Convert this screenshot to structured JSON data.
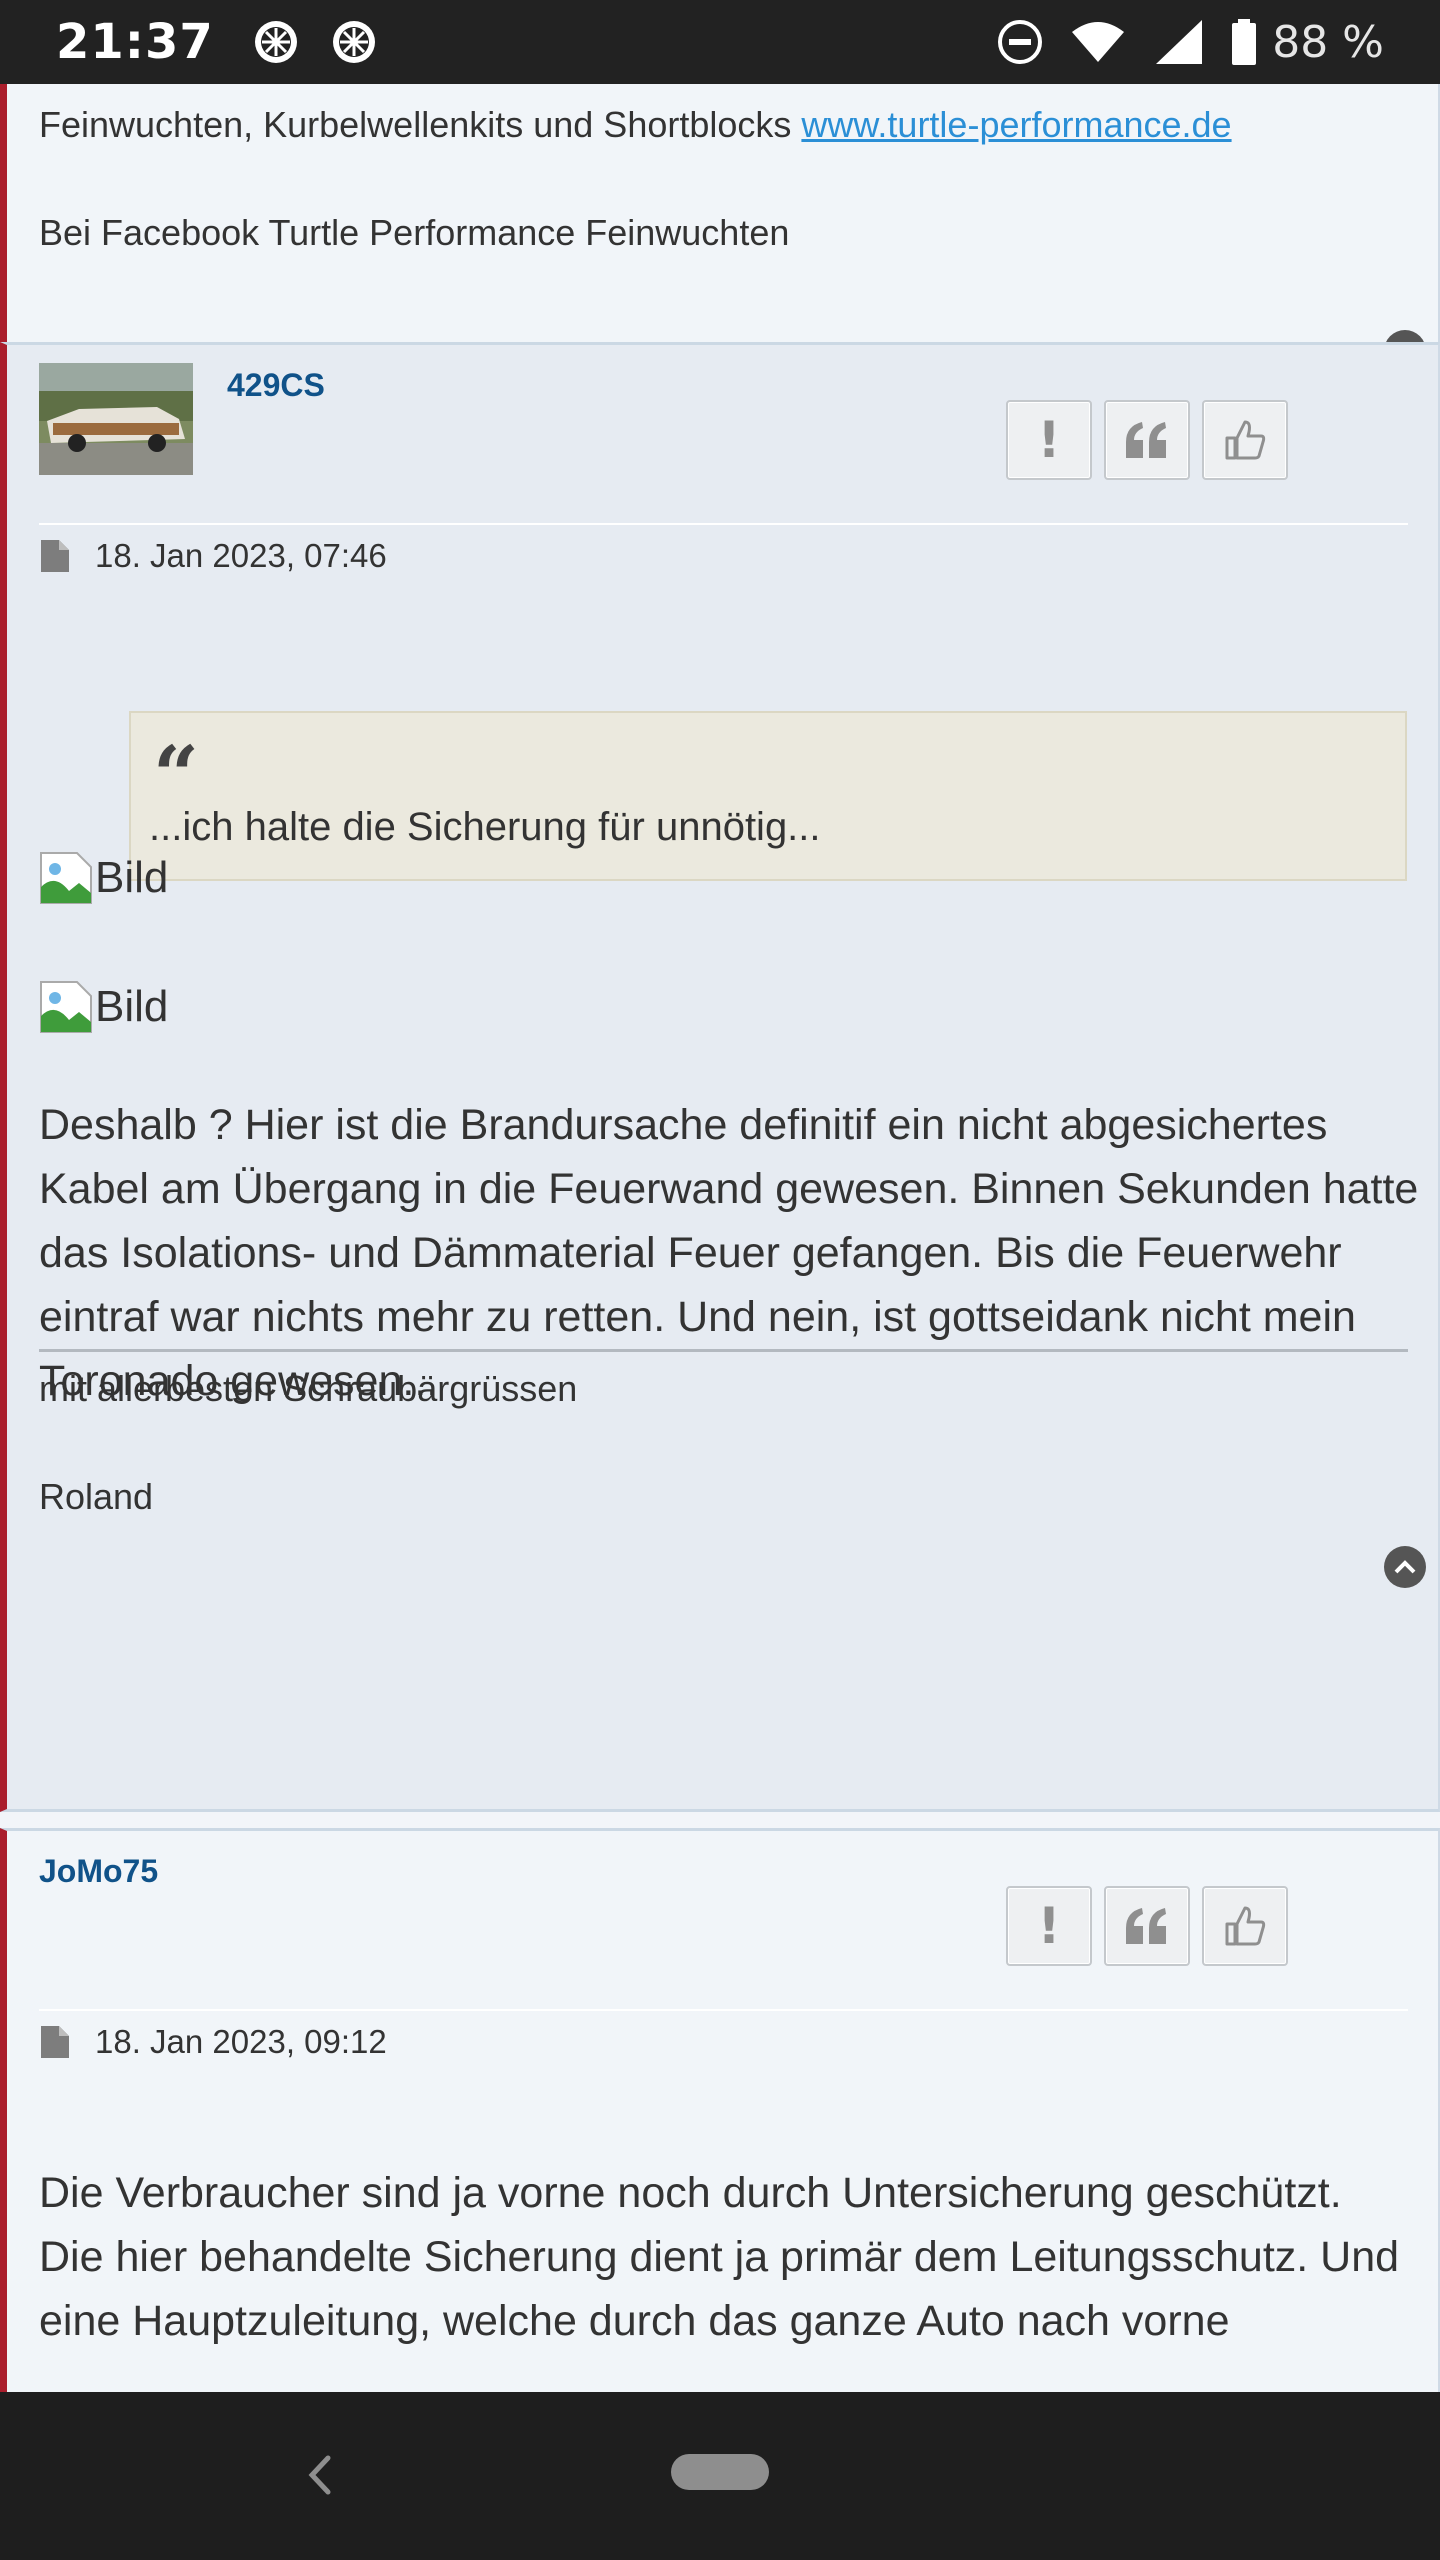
{
  "status_bar": {
    "time": "21:37",
    "battery_text": "88 %",
    "icons": [
      "wheel-icon",
      "wheel-icon",
      "dnd-icon",
      "wifi-icon",
      "signal-icon",
      "battery-icon"
    ]
  },
  "top_post": {
    "signature_text_prefix": "Feinwuchten, Kurbelwellenkits und Shortblocks ",
    "signature_link": "www.turtle-performance.de",
    "signature_line2": "Bei Facebook Turtle Performance Feinwuchten"
  },
  "post1": {
    "username": "429CS",
    "date": "18. Jan 2023, 07:46",
    "quote_text": "...ich halte die Sicherung für unnötig...",
    "images": [
      {
        "alt": "Bild"
      },
      {
        "alt": "Bild"
      }
    ],
    "body": "Deshalb ? Hier ist die Brandursache definitif ein nicht abgesichertes Kabel am Übergang in die Feuerwand gewesen. Binnen Sekunden hatte das Isolations- und Dämmaterial Feuer gefangen. Bis die Feuerwehr eintraf war nichts mehr zu retten. Und nein, ist gottseidank nicht mein Toronado gewesen...",
    "signature_line1": "mit allerbesten Schraubärgrüssen",
    "signature_line2": "Roland"
  },
  "post2": {
    "username": "JoMo75",
    "date": "18. Jan 2023, 09:12",
    "body_line1": "Die Verbraucher sind ja vorne noch durch Untersicherung geschützt.",
    "body_line2": "Die hier behandelte Sicherung dient ja primär dem Leitungsschutz. Und eine Hauptzuleitung, welche durch das ganze Auto nach vorne"
  },
  "colors": {
    "accent_border": "#aa1e2c",
    "username": "#105289",
    "link": "#2b8fd6",
    "quote_bg": "#ebe9de"
  }
}
